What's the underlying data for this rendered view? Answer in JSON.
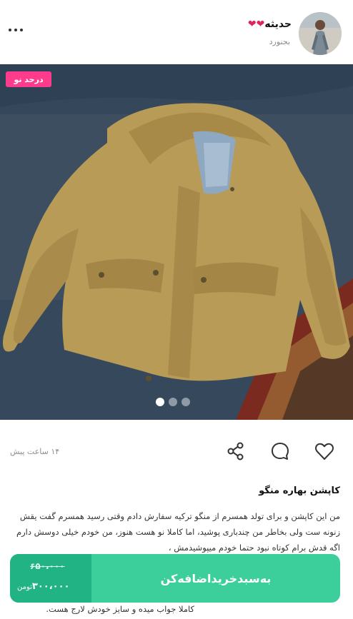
{
  "seller": {
    "name": "حدیثه",
    "hearts": "❤❤",
    "city": "بجنورد",
    "avatar_icon": "user-photo"
  },
  "post": {
    "badge": "درحد نو",
    "image_count": 3,
    "active_image": 1,
    "time_ago": "۱۴ ساعت پیش",
    "title": "کاپشن بهاره منگو",
    "description": "من این کاپشن و برای تولد همسرم از منگو ترکیه سفارش دادم وقتی رسید همسرم گفت یقش زنونه ست ولی بخاطر من چندباری پوشید، اما کاملا نو هست هنوز، من خودم خیلی دوسش دارم اگه قدش برام کوتاه نبود حتما خودم میپوشیدمش ،",
    "description_tail": "کاملا جواب میده و سایز خودش لارج هست."
  },
  "actions": {
    "like_icon": "heart-outline",
    "comment_icon": "chat-bubble",
    "share_icon": "share-nodes"
  },
  "cart": {
    "old_price": "۶۵۰،۰۰۰",
    "new_price": "۳۰۰،۰۰۰",
    "currency": "تومن",
    "button_label": "به‌سبدخریداضافه‌کن"
  },
  "colors": {
    "badge": "#ff3b8d",
    "cart_bg": "#3ccf9c",
    "price_bg": "#22b384"
  }
}
